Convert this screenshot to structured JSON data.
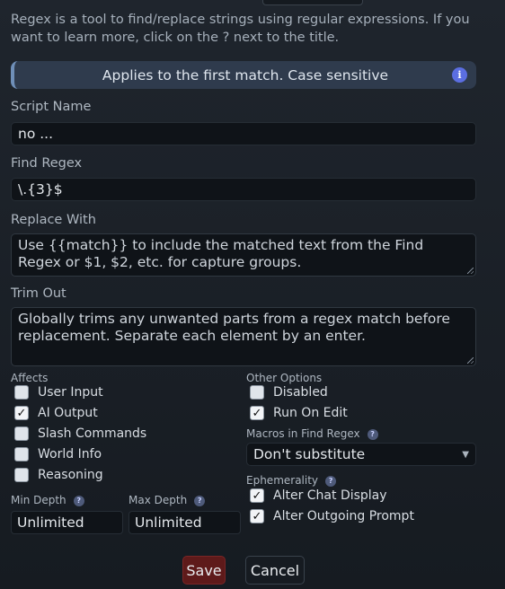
{
  "intro": "Regex is a tool to find/replace strings using regular expressions. If you want to learn more, click on the ? next to the title.",
  "info_bar": {
    "text": "Applies to the first match. Case sensitive",
    "icon": "info-icon"
  },
  "script_name": {
    "label": "Script Name",
    "value": "no ..."
  },
  "find_regex": {
    "label": "Find Regex",
    "value": "\\.{3}$"
  },
  "replace_with": {
    "label": "Replace With",
    "placeholder": "Use {{match}} to include the matched text from the Find Regex or $1, $2, etc. for capture groups."
  },
  "trim_out": {
    "label": "Trim Out",
    "placeholder": "Globally trims any unwanted parts from a regex match before replacement. Separate each element by an enter."
  },
  "affects": {
    "label": "Affects",
    "items": [
      {
        "label": "User Input",
        "checked": false
      },
      {
        "label": "AI Output",
        "checked": true
      },
      {
        "label": "Slash Commands",
        "checked": false
      },
      {
        "label": "World Info",
        "checked": false
      },
      {
        "label": "Reasoning",
        "checked": false
      }
    ]
  },
  "other_options": {
    "label": "Other Options",
    "items": [
      {
        "label": "Disabled",
        "checked": false
      },
      {
        "label": "Run On Edit",
        "checked": true
      }
    ]
  },
  "macros": {
    "label": "Macros in Find Regex",
    "help": "?",
    "value": "Don't substitute"
  },
  "ephemerality": {
    "label": "Ephemerality",
    "help": "?",
    "items": [
      {
        "label": "Alter Chat Display",
        "checked": true
      },
      {
        "label": "Alter Outgoing Prompt",
        "checked": true
      }
    ]
  },
  "min_depth": {
    "label": "Min Depth",
    "help": "?",
    "placeholder": "Unlimited"
  },
  "max_depth": {
    "label": "Max Depth",
    "help": "?",
    "placeholder": "Unlimited"
  },
  "buttons": {
    "save": "Save",
    "cancel": "Cancel"
  },
  "colors": {
    "save_bg": "#5e1a1a",
    "info_bar_bg": "#2f3b4d",
    "accent": "#5b6ee1"
  }
}
